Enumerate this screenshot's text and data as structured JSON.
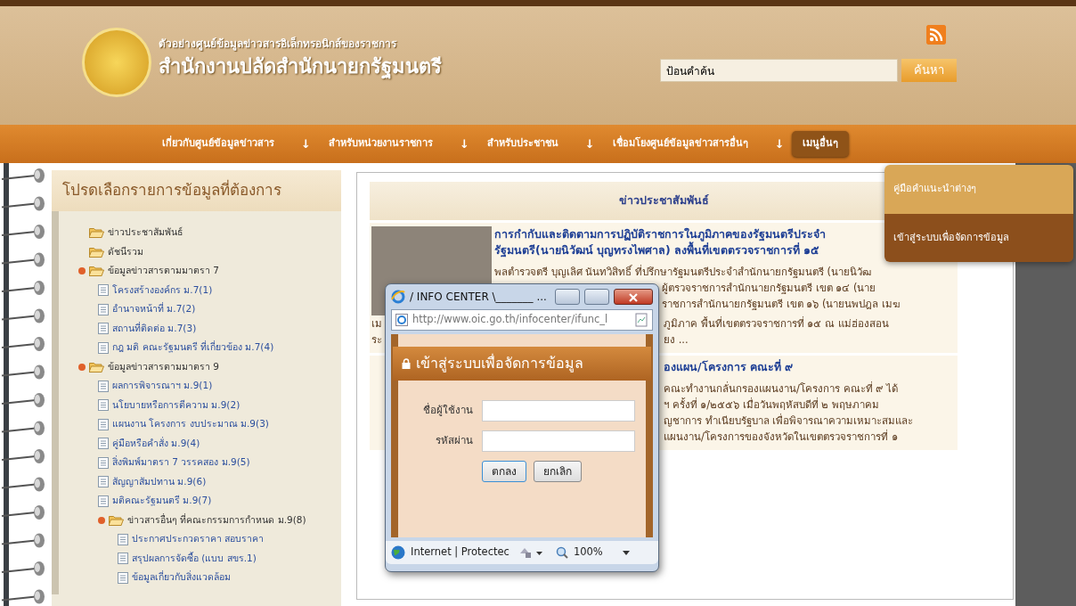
{
  "header": {
    "subtitle": "ตัวอย่างศูนย์ข้อมูลข่าวสารอิเล็กทรอนิกส์ของราชการ",
    "title": "สำนักงานปลัดสำนักนายกรัฐมนตรี",
    "search": {
      "value": "ป้อนคำค้น",
      "button": "ค้นหา"
    }
  },
  "nav": [
    {
      "label": "เกี่ยวกับศูนย์ข้อมูลข่าวสาร",
      "arrow": "↓",
      "selected": false
    },
    {
      "label": "สำหรับหน่วยงานราชการ",
      "arrow": "↓",
      "selected": false
    },
    {
      "label": "สำหรับประชาชน",
      "arrow": "↓",
      "selected": false
    },
    {
      "label": "เชื่อมโยงศูนย์ข้อมูลข่าวสารอื่นๆ",
      "arrow": "↓",
      "selected": false
    },
    {
      "label": "เมนูอื่นๆ",
      "selected": true
    }
  ],
  "dropdown": [
    {
      "label": "คู่มือคำแนะนำต่างๆ",
      "selected": false
    },
    {
      "label": "เข้าสู่ระบบเพื่อจัดการข้อมูล",
      "selected": true
    }
  ],
  "sidebar": {
    "title": "โปรดเลือกรายการข้อมูลที่ต้องการ",
    "items": [
      {
        "label": "ข่าวประชาสัมพันธ์",
        "kind": "folder",
        "expanded": false
      },
      {
        "label": "ดัชนีรวม",
        "kind": "folder",
        "expanded": false
      },
      {
        "label": "ข้อมูลข่าวสารตามมาตรา 7",
        "kind": "folder",
        "expanded": true,
        "children": [
          {
            "label": "โครงสร้างองค์กร ม.7(1)",
            "kind": "doc"
          },
          {
            "label": "อำนาจหน้าที่ ม.7(2)",
            "kind": "doc"
          },
          {
            "label": "สถานที่ติดต่อ ม.7(3)",
            "kind": "doc"
          },
          {
            "label": "กฎ มติ คณะรัฐมนตรี ที่เกี่ยวข้อง ม.7(4)",
            "kind": "doc"
          }
        ]
      },
      {
        "label": "ข้อมูลข่าวสารตามมาตรา 9",
        "kind": "folder",
        "expanded": true,
        "children": [
          {
            "label": "ผลการพิจารณาฯ ม.9(1)",
            "kind": "doc"
          },
          {
            "label": "นโยบายหรือการตีความ ม.9(2)",
            "kind": "doc"
          },
          {
            "label": "แผนงาน โครงการ งบประมาณ ม.9(3)",
            "kind": "doc"
          },
          {
            "label": "คู่มือหรือคำสั่ง ม.9(4)",
            "kind": "doc"
          },
          {
            "label": "สิ่งพิมพ์มาตรา 7 วรรคสอง ม.9(5)",
            "kind": "doc"
          },
          {
            "label": "สัญญาสัมปทาน ม.9(6)",
            "kind": "doc"
          },
          {
            "label": "มติคณะรัฐมนตรี ม.9(7)",
            "kind": "doc"
          },
          {
            "label": "ข่าวสารอื่นๆ ที่คณะกรรมการกำหนด ม.9(8)",
            "kind": "folder",
            "expanded": true,
            "children": [
              {
                "label": "ประกาศประกวดราคา สอบราคา",
                "kind": "doc"
              },
              {
                "label": "สรุปผลการจัดซื้อ (แบบ สขร.1)",
                "kind": "doc"
              },
              {
                "label": "ข้อมูลเกี่ยวกับสิ่งแวดล้อม",
                "kind": "doc"
              }
            ]
          }
        ]
      }
    ]
  },
  "news": {
    "title": "ข่าวประชาสัมพันธ์",
    "items": [
      {
        "photo": true,
        "beside": [
          {
            "kind": "title",
            "text": "การกำกับและติดตามการปฏิบัติราชการในภูมิภาคของรัฐมนตรีประจำ"
          },
          {
            "kind": "title",
            "text": "รัฐมนตรี(นายนิวัฒน์ บุญทรงไพศาล) ลงพื้นที่เขตตรวจราชการที่ ๑๕"
          },
          {
            "kind": "text",
            "covered": false,
            "text": "พลตำรวจตรี บุญเลิศ นันทวิสิทธิ์ ที่ปรึกษารัฐมนตรีประจำสำนักนายกรัฐมนตรี (นายนิวัฒ"
          },
          {
            "kind": "text",
            "covered": true,
            "text": "ผู้ตรวจราชการสำนักนายกรัฐมนตรี เขต ๑๔ (นาย"
          },
          {
            "kind": "text",
            "covered": true,
            "text": "ราชการสำนักนายกรัฐมนตรี เขต ๑๖ (นายนพปฎล เมฆ"
          }
        ],
        "below": [
          {
            "kind": "text",
            "covered": true,
            "left": "เม",
            "text": "ภูมิภาค พื้นที่เขตตรวจราชการที่ ๑๕ ณ แม่ฮ่องสอน"
          },
          {
            "kind": "text",
            "covered": true,
            "left": "ระ",
            "text": "ยง ..."
          }
        ]
      },
      {
        "photo": false,
        "below": [
          {
            "kind": "title",
            "covered": true,
            "text": "องแผน/โครงการ คณะที่ ๙"
          },
          {
            "kind": "text",
            "covered": true,
            "text": "คณะทำงานกลั่นกรองแผนงาน/โครงการ คณะที่ ๙ ได้"
          },
          {
            "kind": "text",
            "covered": true,
            "text": "ฯ ครั้งที่ ๑/๒๕๕๖ เมื่อวันพฤหัสบดีที่ ๒ พฤษภาคม"
          },
          {
            "kind": "text",
            "covered": true,
            "text": "ญชาการ ทำเนียบรัฐบาล เพื่อพิจารณาความเหมาะสมและ"
          },
          {
            "kind": "text",
            "covered": true,
            "text": "แผนงาน/โครงการของจังหวัดในเขตตรวจราชการที่ ๑"
          }
        ]
      }
    ]
  },
  "popup": {
    "title": "/ INFO CENTER \\_______ ...",
    "address": "http://www.oic.go.th/infocenter/ifunc_l",
    "heading": "เข้าสู่ระบบเพื่อจัดการข้อมูล",
    "fields": [
      {
        "label": "ชื่อผู้ใช้งาน"
      },
      {
        "label": "รหัสผ่าน"
      }
    ],
    "buttons": [
      "ตกลง",
      "ยกเลิก"
    ],
    "status": "Internet | Protectec",
    "zoom": "100%"
  }
}
